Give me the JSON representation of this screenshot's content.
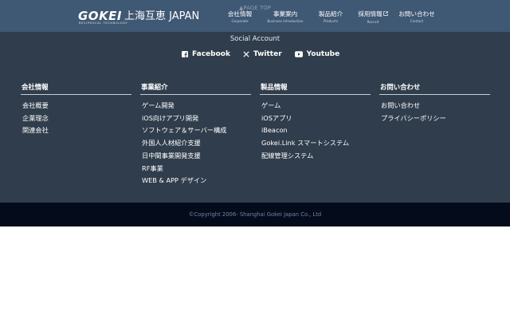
{
  "header": {
    "logo_text": "GOKEI",
    "logo_tagline": "RECIPROCAL TECHNOLOGY",
    "company_name": "上海互恵 JAPAN",
    "page_top": "▲PAGE TOP",
    "nav": [
      {
        "label": "会社情報",
        "sub": "Corporate"
      },
      {
        "label": "事業案内",
        "sub": "Business Introduction"
      },
      {
        "label": "製品紹介",
        "sub": "Products"
      },
      {
        "label": "採用情報",
        "sub": "Recruit"
      },
      {
        "label": "お問い合わせ",
        "sub": "Contact"
      }
    ]
  },
  "social": {
    "title": "Social Account",
    "links": [
      {
        "label": "Facebook",
        "icon": "facebook-icon"
      },
      {
        "label": "Twitter",
        "icon": "x-icon"
      },
      {
        "label": "Youtube",
        "icon": "youtube-icon"
      }
    ]
  },
  "columns": [
    {
      "heading": "会社情報",
      "items": [
        "会社概要",
        "企業理念",
        "関連会社"
      ]
    },
    {
      "heading": "事業紹介",
      "items": [
        "ゲーム開発",
        "iOS向けアプリ開発",
        "ソフトウェア＆サーバー構成",
        "外国人人材紹介支援",
        "日中間事業開発支援",
        "RF事業",
        "WEB & APP デザイン"
      ]
    },
    {
      "heading": "製品情報",
      "items": [
        "ゲーム",
        "iOSアプリ",
        "iBeacon",
        "Gokei.Link スマートシステム",
        "配線管理システム"
      ]
    },
    {
      "heading": "お問い合わせ",
      "items": [
        "お問い合わせ",
        "プライバシーポリシー"
      ]
    }
  ],
  "footer": {
    "copyright": "©Copyright 2006- Shanghai Gokei Japan Co., Ltd"
  },
  "colors": {
    "header_bg": "#3f5874",
    "footer_bg": "#303d4c",
    "bottom_bg": "#040b1a"
  }
}
